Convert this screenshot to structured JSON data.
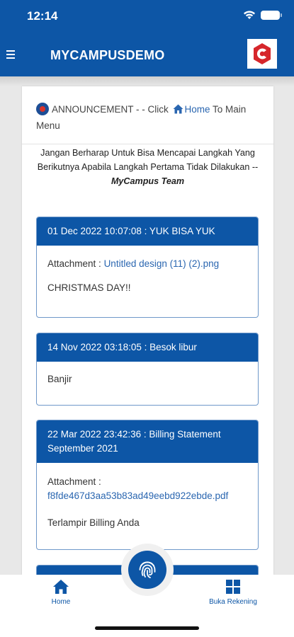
{
  "status": {
    "time": "12:14"
  },
  "appbar": {
    "title": "MYCAMPUSDEMO",
    "logo_letter": "C"
  },
  "announcement": {
    "prefix": "ANNOUNCEMENT - - Click",
    "home_link": "Home",
    "suffix": "To Main Menu"
  },
  "quote": {
    "text": "Jangan Berharap Untuk Bisa Mencapai Langkah Yang Berikutnya Apabila Langkah Pertama Tidak Dilakukan --",
    "author": "MyCampus Team"
  },
  "cards": [
    {
      "header": "01 Dec 2022 10:07:08 : YUK BISA YUK",
      "attachment_label": "Attachment :",
      "attachment_file": "Untitled design (11) (2).png",
      "message": "CHRISTMAS DAY!!"
    },
    {
      "header": "14 Nov 2022 03:18:05 : Besok libur",
      "message": "Banjir"
    },
    {
      "header": "22 Mar 2022 23:42:36 : Billing Statement September 2021",
      "attachment_label": "Attachment :",
      "attachment_file": "f8fde467d3aa53b83ad49eebd922ebde.pdf",
      "message": "Terlampir Billing Anda"
    }
  ],
  "bottom_nav": {
    "home": "Home",
    "buka_rekening": "Buka Rekening"
  },
  "colors": {
    "primary": "#0d56a6",
    "link": "#2a66b0",
    "card_border": "#6f98c9"
  }
}
